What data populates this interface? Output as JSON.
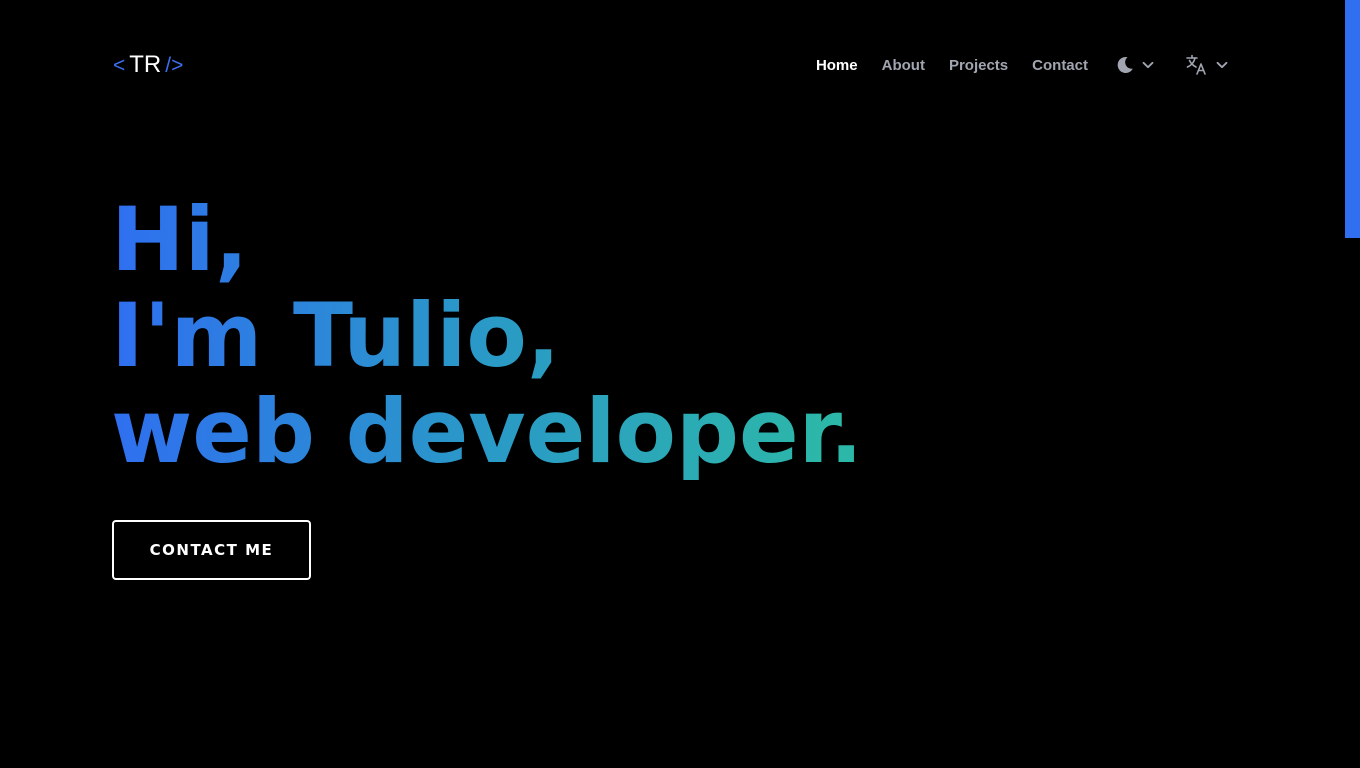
{
  "logo": {
    "open_bracket": "<",
    "initials": "TR",
    "close_bracket": "/>"
  },
  "nav": {
    "items": [
      {
        "label": "Home",
        "active": true
      },
      {
        "label": "About",
        "active": false
      },
      {
        "label": "Projects",
        "active": false
      },
      {
        "label": "Contact",
        "active": false
      }
    ],
    "theme_icon": "moon-icon",
    "language_icon": "translate-icon"
  },
  "hero": {
    "line1": "Hi,",
    "line2": "I'm Tulio,",
    "line3": "web developer.",
    "gradient": [
      "#2f6ff0",
      "#2a98c8",
      "#2cb8a8"
    ]
  },
  "cta": {
    "label": "CONTACT ME"
  },
  "colors": {
    "background": "#000000",
    "accent": "#2f6ff0",
    "nav_inactive": "#a1a5b0"
  }
}
